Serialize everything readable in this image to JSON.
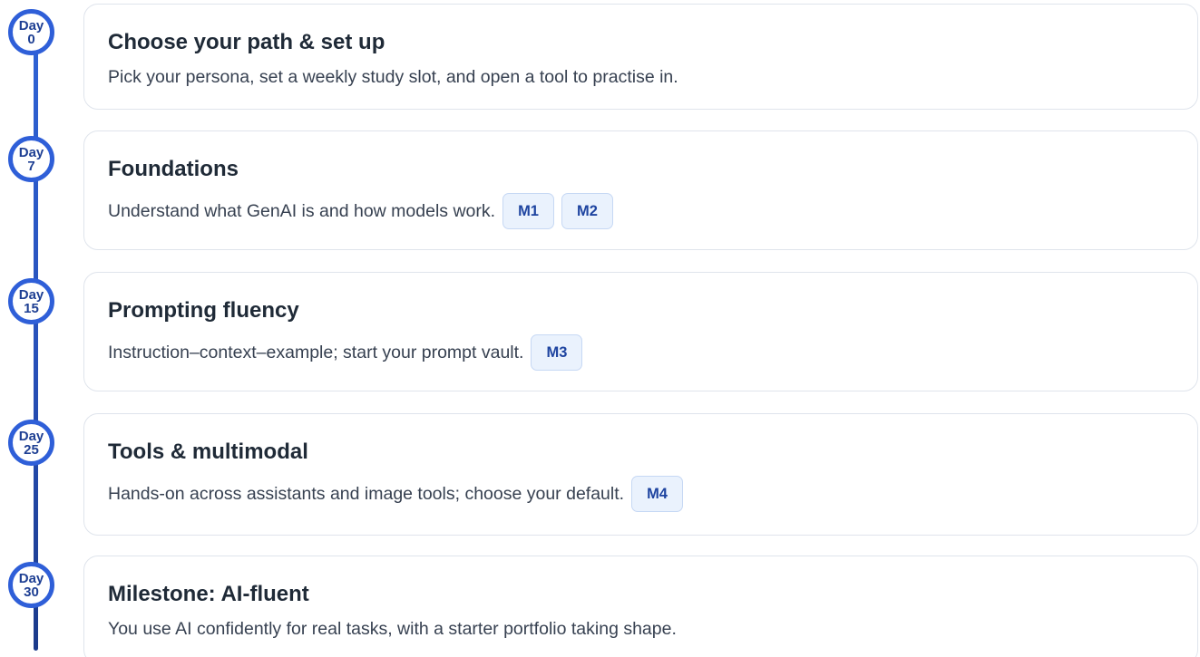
{
  "steps": [
    {
      "day_word": "Day",
      "day_number": "0",
      "title": "Choose your path & set up",
      "description": "Pick your persona, set a weekly study slot, and open a tool to practise in.",
      "modules": []
    },
    {
      "day_word": "Day",
      "day_number": "7",
      "title": "Foundations",
      "description": "Understand what GenAI is and how models work.",
      "modules": [
        "M1",
        "M2"
      ]
    },
    {
      "day_word": "Day",
      "day_number": "15",
      "title": "Prompting fluency",
      "description": "Instruction–context–example; start your prompt vault.",
      "modules": [
        "M3"
      ]
    },
    {
      "day_word": "Day",
      "day_number": "25",
      "title": "Tools & multimodal",
      "description": "Hands-on across assistants and image tools; choose your default.",
      "modules": [
        "M4"
      ]
    },
    {
      "day_word": "Day",
      "day_number": "30",
      "title": "Milestone: AI-fluent",
      "description": "You use AI confidently for real tasks, with a starter portfolio taking shape.",
      "modules": []
    }
  ],
  "colors": {
    "accent": "#2f5fd8",
    "accent_dark": "#1b3a8a",
    "chip_bg": "#eaf2fd",
    "chip_text": "#1e44a0",
    "card_border": "#dfe4ec"
  }
}
